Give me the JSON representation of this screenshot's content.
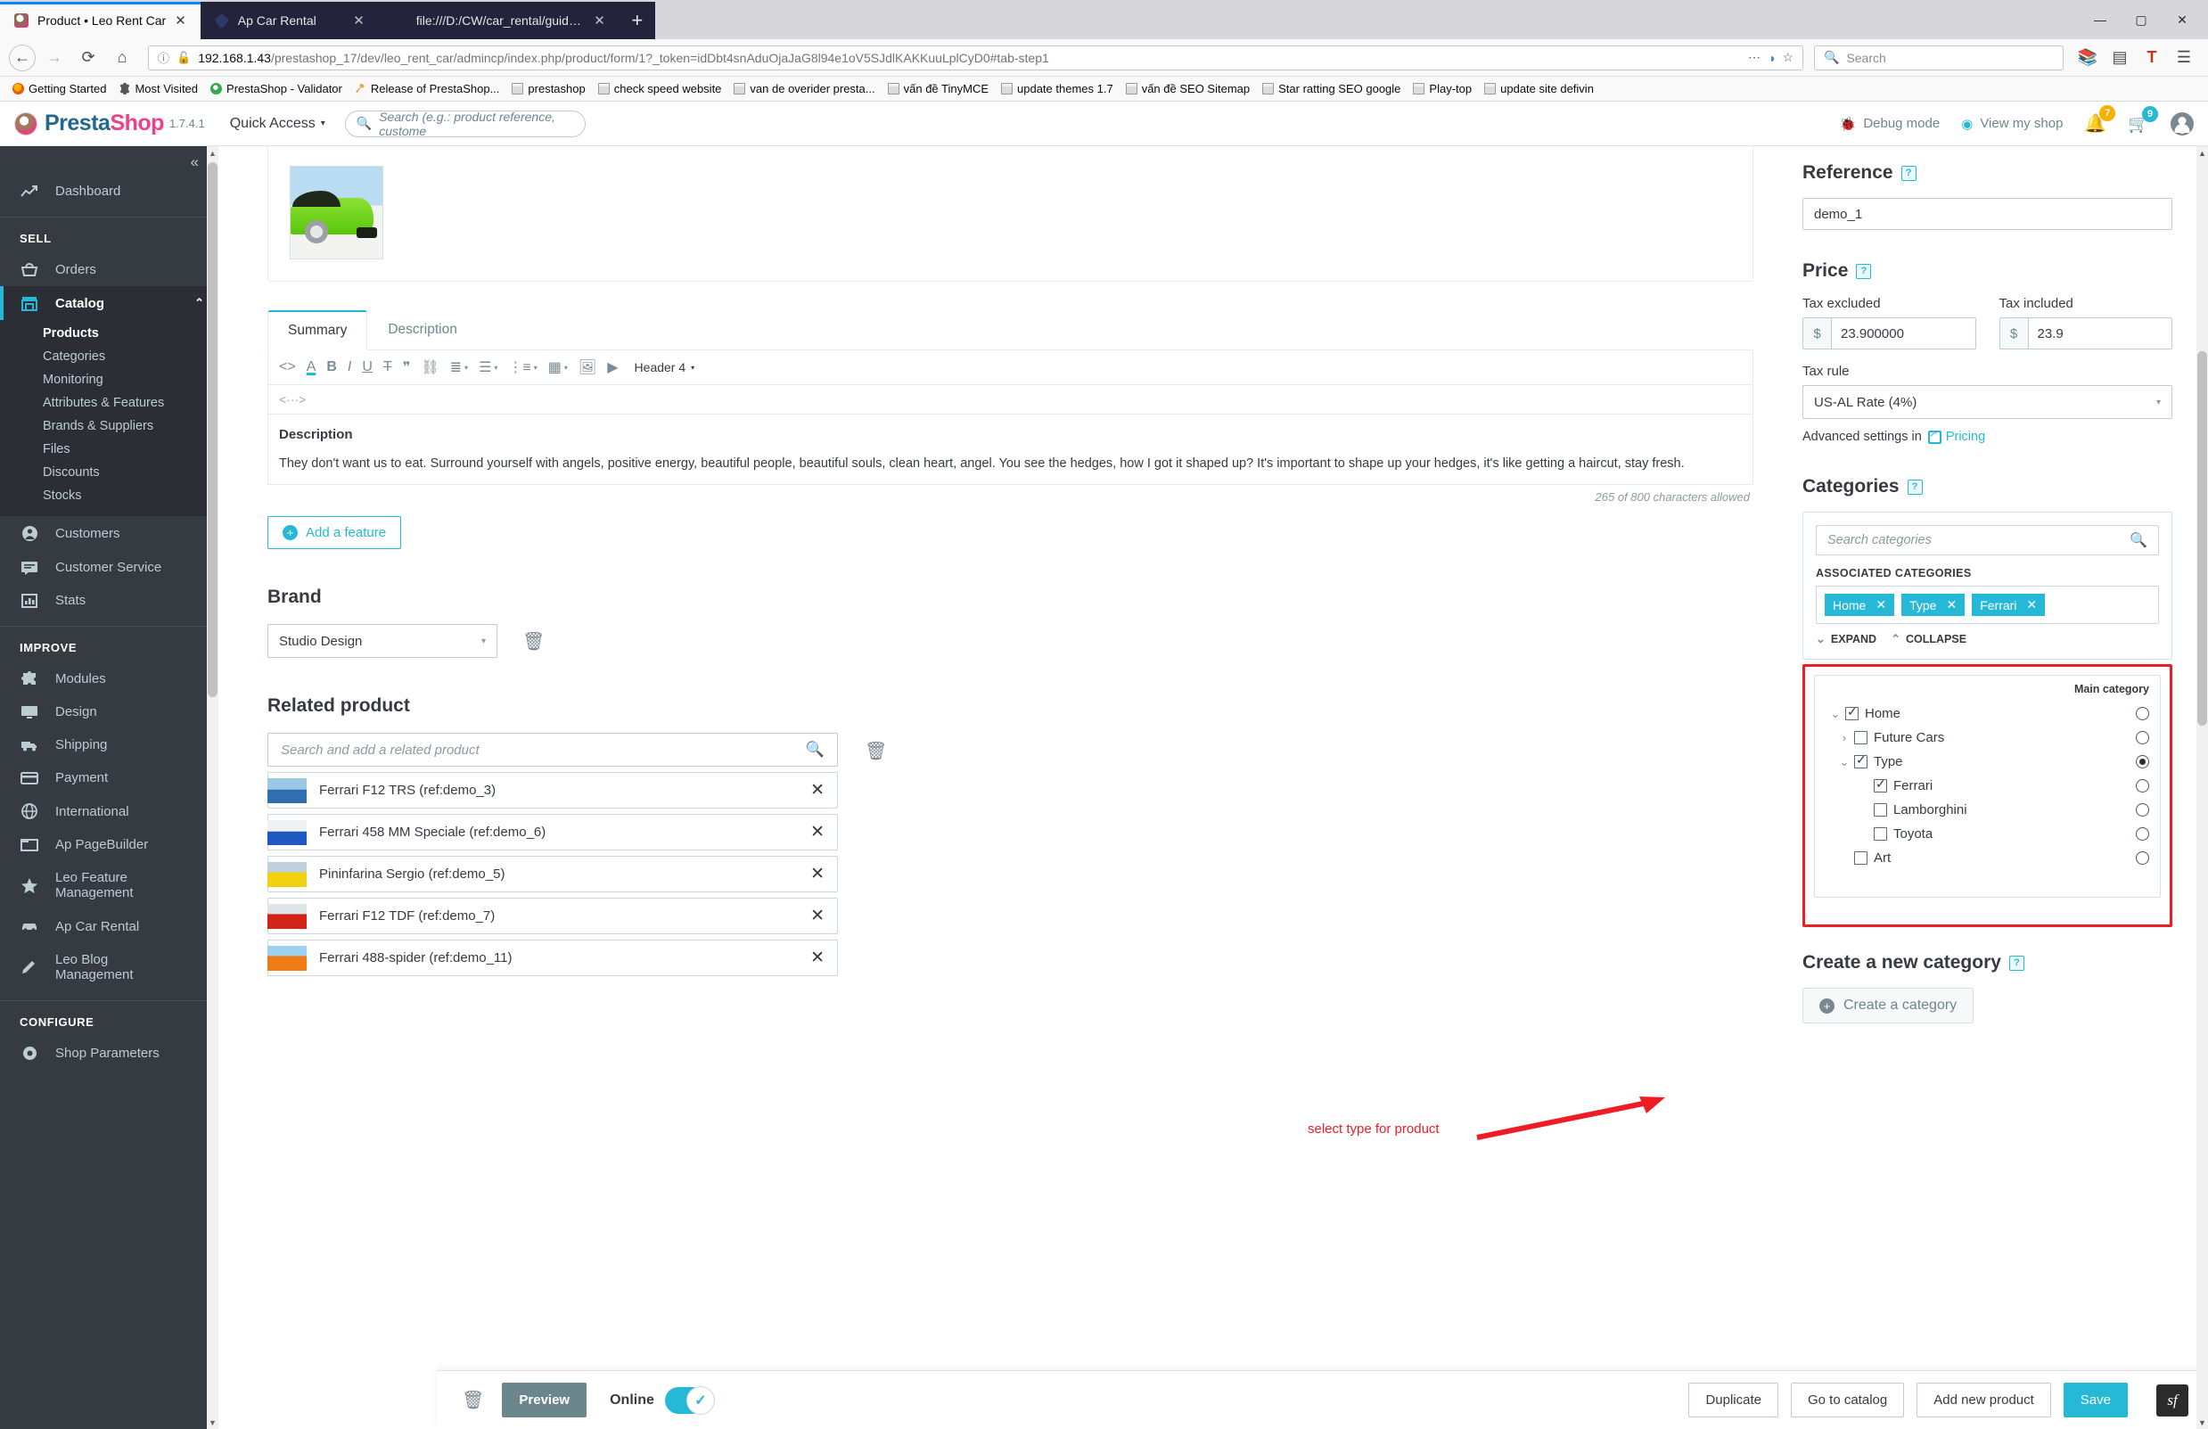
{
  "browser": {
    "tabs": [
      {
        "title": "Product • Leo Rent Car",
        "favicon": "prestashop-icon",
        "active": true,
        "close": "✕"
      },
      {
        "title": "Ap Car Rental",
        "favicon": "leaf-icon",
        "active": false,
        "close": "✕"
      },
      {
        "title": "file:///D:/CW/car_rental/guide/apre",
        "favicon": "blank-icon",
        "active": false,
        "close": "✕"
      }
    ],
    "new_tab_label": "+",
    "window_buttons": {
      "minimize": "—",
      "maximize": "▢",
      "close": "✕"
    },
    "nav": {
      "back": "←",
      "forward": "→",
      "reload": "⟳",
      "home": "⌂"
    },
    "url": {
      "host": "192.168.1.43",
      "path": "/prestashop_17/dev/leo_rent_car/admincp/index.php/product/form/1?_token=idDbt4snAduOjaJaG8l94e1oV5SJdlKAKKuuLplCyD0#tab-step1",
      "info_icon": "info-icon",
      "broken_lock_icon": "broken-lock-icon",
      "page_actions": "⋯",
      "pocket_icon": "pocket-icon",
      "bookmark_star": "☆"
    },
    "search": {
      "placeholder": "Search",
      "icon": "search-icon"
    },
    "toolbar_right": {
      "library": "library-icon",
      "sidebar": "sidebar-icon",
      "account": "T",
      "menu": "☰"
    },
    "bookmarks": [
      {
        "label": "Getting Started",
        "icon": "firefox-icon"
      },
      {
        "label": "Most Visited",
        "icon": "gear-icon"
      },
      {
        "label": "PrestaShop - Validator",
        "icon": "green-globe-icon"
      },
      {
        "label": "Release of PrestaShop...",
        "icon": "tool-icon"
      },
      {
        "label": "prestashop",
        "icon": "folder-icon"
      },
      {
        "label": "check speed website",
        "icon": "folder-icon"
      },
      {
        "label": "van de overider presta...",
        "icon": "folder-icon"
      },
      {
        "label": "vấn đề TinyMCE",
        "icon": "folder-icon"
      },
      {
        "label": "update themes 1.7",
        "icon": "folder-icon"
      },
      {
        "label": "vấn đề SEO Sitemap",
        "icon": "folder-icon"
      },
      {
        "label": "Star ratting SEO google",
        "icon": "folder-icon"
      },
      {
        "label": "Play-top",
        "icon": "folder-icon"
      },
      {
        "label": "update site defivin",
        "icon": "folder-icon"
      }
    ]
  },
  "header": {
    "brand_part1": "Presta",
    "brand_part2": "Shop",
    "version": "1.7.4.1",
    "quick_access": "Quick Access",
    "quick_access_caret": "▾",
    "search_placeholder": "Search (e.g.: product reference, custome",
    "search_icon": "search-icon",
    "debug_mode": "Debug mode",
    "debug_icon": "bug-icon",
    "view_shop": "View my shop",
    "view_shop_icon": "eye-icon",
    "notifications_icon": "bell-icon",
    "notifications_count": "7",
    "orders_icon": "cart-icon",
    "orders_count": "9",
    "avatar": "avatar-icon"
  },
  "sidebar": {
    "collapse_icon": "«",
    "dashboard": {
      "label": "Dashboard",
      "icon": "trending-up-icon"
    },
    "sections": [
      {
        "title": "SELL",
        "items": [
          {
            "label": "Orders",
            "icon": "basket-icon",
            "active": false
          },
          {
            "label": "Catalog",
            "icon": "store-icon",
            "active": true,
            "chevron": "⌃",
            "children": [
              {
                "label": "Products",
                "current": true
              },
              {
                "label": "Categories",
                "current": false
              },
              {
                "label": "Monitoring",
                "current": false
              },
              {
                "label": "Attributes & Features",
                "current": false
              },
              {
                "label": "Brands & Suppliers",
                "current": false
              },
              {
                "label": "Files",
                "current": false
              },
              {
                "label": "Discounts",
                "current": false
              },
              {
                "label": "Stocks",
                "current": false
              }
            ]
          },
          {
            "label": "Customers",
            "icon": "person-icon",
            "active": false
          },
          {
            "label": "Customer Service",
            "icon": "chat-icon",
            "active": false
          },
          {
            "label": "Stats",
            "icon": "bars-icon",
            "active": false
          }
        ]
      },
      {
        "title": "IMPROVE",
        "items": [
          {
            "label": "Modules",
            "icon": "puzzle-icon",
            "active": false
          },
          {
            "label": "Design",
            "icon": "monitor-icon",
            "active": false
          },
          {
            "label": "Shipping",
            "icon": "truck-icon",
            "active": false
          },
          {
            "label": "Payment",
            "icon": "card-icon",
            "active": false
          },
          {
            "label": "International",
            "icon": "globe-icon",
            "active": false
          },
          {
            "label": "Ap PageBuilder",
            "icon": "window-icon",
            "active": false
          },
          {
            "label": "Leo Feature Management",
            "icon": "star-icon",
            "active": false
          },
          {
            "label": "Ap Car Rental",
            "icon": "car-icon",
            "active": false
          },
          {
            "label": "Leo Blog Management",
            "icon": "pencil-icon",
            "active": false
          }
        ]
      },
      {
        "title": "CONFIGURE",
        "items": [
          {
            "label": "Shop Parameters",
            "icon": "gear-icon",
            "active": false
          }
        ]
      }
    ]
  },
  "main": {
    "product_image_alt": "green-sports-car-thumbnail",
    "tabs": [
      {
        "label": "Summary",
        "active": true
      },
      {
        "label": "Description",
        "active": false
      }
    ],
    "editor": {
      "icons": [
        "code-icon",
        "font-color-icon",
        "bold-icon",
        "italic-icon",
        "underline-icon",
        "strikethrough-icon",
        "quote-icon",
        "link-icon",
        "align-icon",
        "bullet-list-icon",
        "numbered-list-icon",
        "table-icon",
        "image-icon",
        "video-icon"
      ],
      "format_label": "Header 4",
      "format_caret": "▾",
      "second_row_icon": "source-code-icon",
      "body_heading": "Description",
      "body_text": "They don't want us to eat. Surround yourself with angels, positive energy, beautiful people, beautiful souls, clean heart, angel. You see the hedges, how I got it shaped up? It's important to shape up your hedges, it's like getting a haircut, stay fresh.",
      "char_count": "265 of 800 characters allowed"
    },
    "add_feature_button": "Add a feature",
    "brand": {
      "title": "Brand",
      "value": "Studio Design",
      "caret": "▾",
      "delete_icon": "trash-icon"
    },
    "related": {
      "title": "Related product",
      "search_placeholder": "Search and add a related product",
      "search_icon": "search-icon",
      "delete_icon": "trash-icon",
      "items": [
        {
          "label": "Ferrari F12 TRS (ref:demo_3)",
          "thumb": "blue-car",
          "remove": "✕"
        },
        {
          "label": "Ferrari 458 MM Speciale (ref:demo_6)",
          "thumb": "blue-car-2",
          "remove": "✕"
        },
        {
          "label": "Pininfarina Sergio (ref:demo_5)",
          "thumb": "yellow-car",
          "remove": "✕"
        },
        {
          "label": "Ferrari F12 TDF (ref:demo_7)",
          "thumb": "red-car",
          "remove": "✕"
        },
        {
          "label": "Ferrari 488-spider (ref:demo_11)",
          "thumb": "orange-car",
          "remove": "✕"
        }
      ]
    }
  },
  "right": {
    "reference": {
      "title": "Reference",
      "help": "?",
      "value": "demo_1"
    },
    "price": {
      "title": "Price",
      "help": "?",
      "tax_excluded_label": "Tax excluded",
      "tax_excluded_currency": "$",
      "tax_excluded_value": "23.900000",
      "tax_included_label": "Tax included",
      "tax_included_currency": "$",
      "tax_included_value": "23.9",
      "tax_rule_label": "Tax rule",
      "tax_rule_value": "US-AL Rate (4%)",
      "tax_rule_caret": "▾",
      "advanced_prefix": "Advanced settings in",
      "advanced_link": "Pricing",
      "advanced_link_icon": "external-link-icon"
    },
    "categories": {
      "title": "Categories",
      "help": "?",
      "search_placeholder": "Search categories",
      "search_icon": "search-icon",
      "associated_label": "ASSOCIATED CATEGORIES",
      "tags": [
        {
          "label": "Home",
          "remove": "✕"
        },
        {
          "label": "Type",
          "remove": "✕"
        },
        {
          "label": "Ferrari",
          "remove": "✕"
        }
      ],
      "expand_label": "EXPAND",
      "expand_icon": "chevron-down-icon",
      "collapse_label": "COLLAPSE",
      "collapse_icon": "chevron-up-icon",
      "main_category_header": "Main category",
      "tree": [
        {
          "label": "Home",
          "indent": 0,
          "twisty": "⌄",
          "checked": true,
          "main": false
        },
        {
          "label": "Future Cars",
          "indent": 1,
          "twisty": "›",
          "checked": false,
          "main": false
        },
        {
          "label": "Type",
          "indent": 1,
          "twisty": "⌄",
          "checked": true,
          "main": true
        },
        {
          "label": "Ferrari",
          "indent": 2,
          "twisty": "",
          "checked": true,
          "main": false
        },
        {
          "label": "Lamborghini",
          "indent": 2,
          "twisty": "",
          "checked": false,
          "main": false
        },
        {
          "label": "Toyota",
          "indent": 2,
          "twisty": "",
          "checked": false,
          "main": false
        },
        {
          "label": "Art",
          "indent": 1,
          "twisty": "",
          "checked": false,
          "main": false
        }
      ]
    },
    "new_category": {
      "title": "Create a new category",
      "help": "?",
      "button": "Create a category"
    }
  },
  "annotation": {
    "text": "select type for product",
    "color": "#ee1c25"
  },
  "footer": {
    "delete_icon": "trash-icon",
    "preview": "Preview",
    "online_label": "Online",
    "toggle_on": true,
    "toggle_check": "✓",
    "duplicate": "Duplicate",
    "go_to_catalog": "Go to catalog",
    "add_new_product": "Add new product",
    "save": "Save",
    "symfony_badge": "sf"
  }
}
